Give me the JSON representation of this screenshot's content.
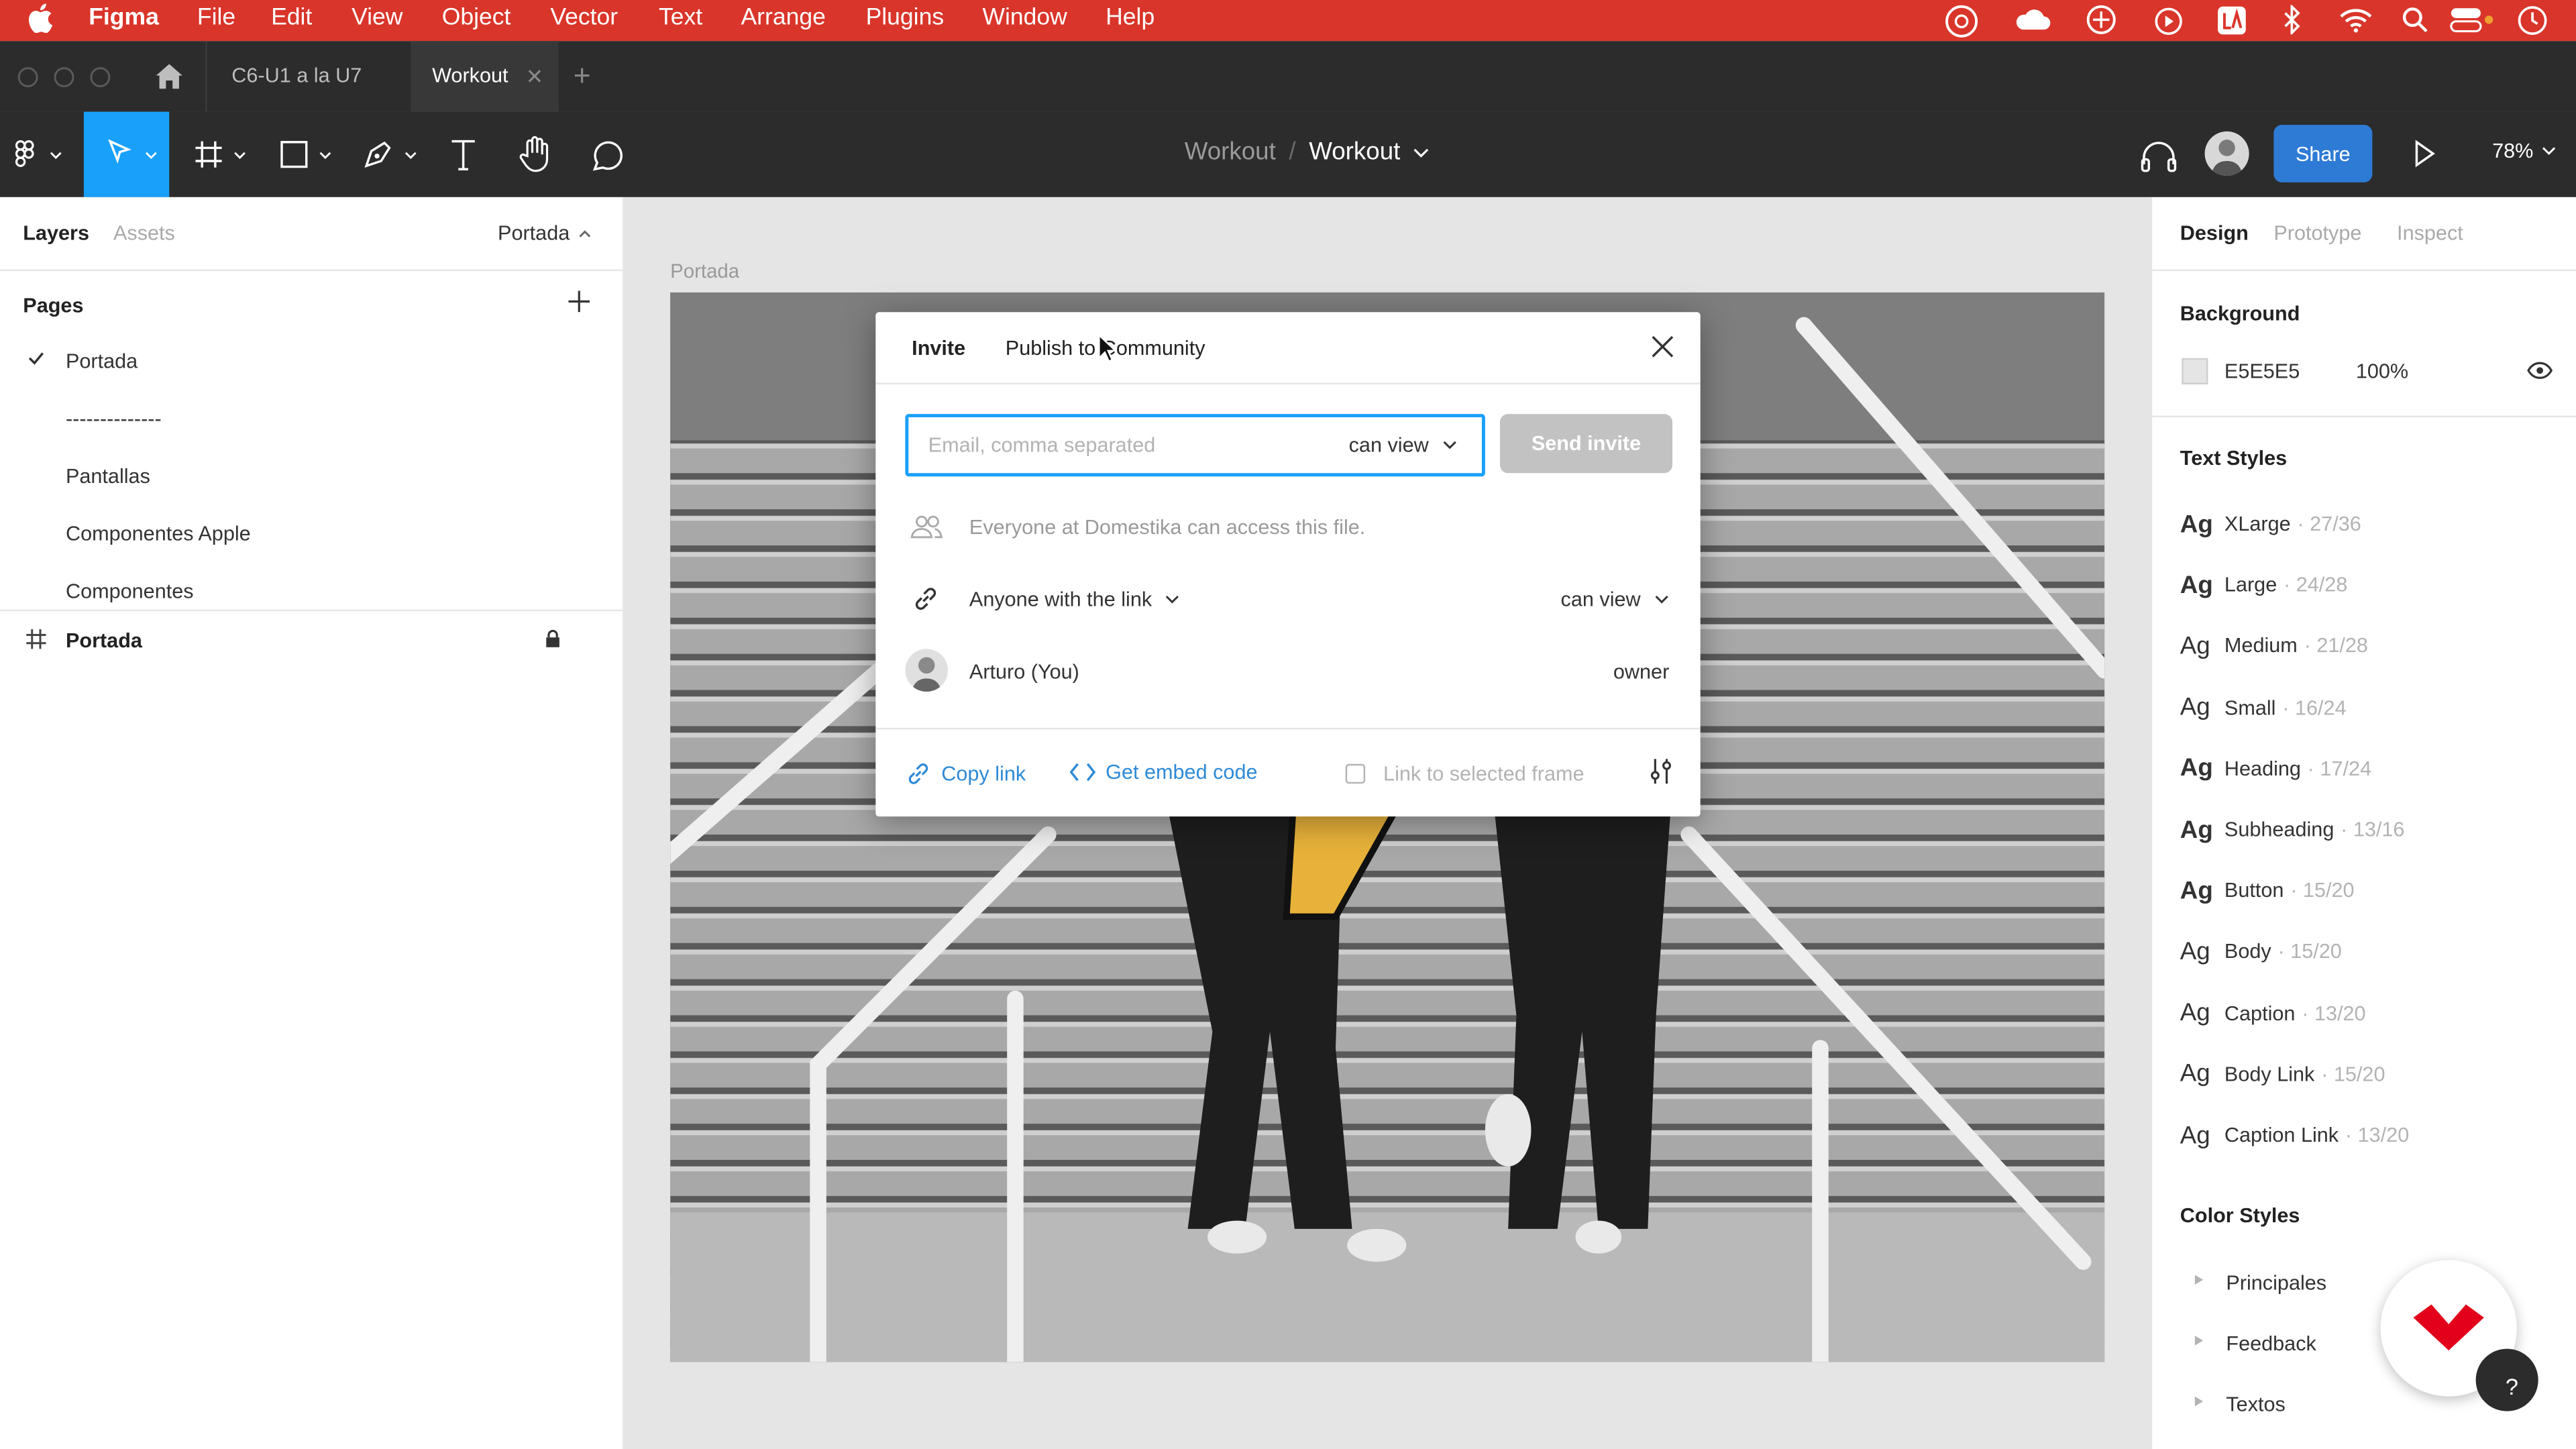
{
  "menubar": {
    "app": "Figma",
    "items": [
      "File",
      "Edit",
      "View",
      "Object",
      "Vector",
      "Text",
      "Arrange",
      "Plugins",
      "Window",
      "Help"
    ]
  },
  "tabs": {
    "items": [
      {
        "label": "C6-U1 a la U7"
      },
      {
        "label": "Workout"
      }
    ]
  },
  "toolbar": {
    "breadcrumb_project": "Workout",
    "breadcrumb_separator": "/",
    "breadcrumb_file": "Workout",
    "share_label": "Share",
    "zoom": "78%"
  },
  "left_panel": {
    "tab_layers": "Layers",
    "tab_assets": "Assets",
    "page_selector": "Portada",
    "pages_title": "Pages",
    "pages": [
      "Portada",
      "--------------",
      "Pantallas",
      "Componentes Apple",
      "Componentes"
    ],
    "current_page_index": 0,
    "layers": [
      {
        "name": "Portada"
      }
    ]
  },
  "canvas": {
    "frame_label": "Portada"
  },
  "share_modal": {
    "tab_invite": "Invite",
    "tab_publish": "Publish to Community",
    "email_placeholder": "Email, comma separated",
    "invite_permission": "can view",
    "send_label": "Send invite",
    "org_access_text": "Everyone at Domestika can access this file.",
    "link_access": "Anyone with the link",
    "link_permission": "can view",
    "user_name": "Arturo (You)",
    "user_role": "owner",
    "copy_link": "Copy link",
    "embed_code": "Get embed code",
    "link_selected_frame": "Link to selected frame"
  },
  "right_panel": {
    "tab_design": "Design",
    "tab_prototype": "Prototype",
    "tab_inspect": "Inspect",
    "background_title": "Background",
    "background_hex": "E5E5E5",
    "background_opacity": "100%",
    "background_color": "#e5e5e5",
    "text_styles_title": "Text Styles",
    "text_styles": [
      {
        "ag": "Ag",
        "name": "XLarge",
        "meta": "· 27/36",
        "weight": "bold"
      },
      {
        "ag": "Ag",
        "name": "Large",
        "meta": "· 24/28",
        "weight": "bold"
      },
      {
        "ag": "Ag",
        "name": "Medium",
        "meta": "· 21/28",
        "weight": "normal"
      },
      {
        "ag": "Ag",
        "name": "Small",
        "meta": "· 16/24",
        "weight": "normal"
      },
      {
        "ag": "Ag",
        "name": "Heading",
        "meta": "· 17/24",
        "weight": "bold"
      },
      {
        "ag": "Ag",
        "name": "Subheading",
        "meta": "· 13/16",
        "weight": "bold"
      },
      {
        "ag": "Ag",
        "name": "Button",
        "meta": "· 15/20",
        "weight": "bold"
      },
      {
        "ag": "Ag",
        "name": "Body",
        "meta": "· 15/20",
        "weight": "normal"
      },
      {
        "ag": "Ag",
        "name": "Caption",
        "meta": "· 13/20",
        "weight": "normal"
      },
      {
        "ag": "Ag",
        "name": "Body Link",
        "meta": "· 15/20",
        "weight": "normal"
      },
      {
        "ag": "Ag",
        "name": "Caption Link",
        "meta": "· 13/20",
        "weight": "normal"
      }
    ],
    "color_styles_title": "Color Styles",
    "color_styles": [
      "Principales",
      "Feedback",
      "Textos"
    ]
  },
  "help_label": "?",
  "colors": {
    "menubar": "#d9352a",
    "dark_ui": "#2c2c2c",
    "accent": "#18a0fb",
    "share_button": "#2e7bd6",
    "domestika_red": "#e2001a"
  }
}
